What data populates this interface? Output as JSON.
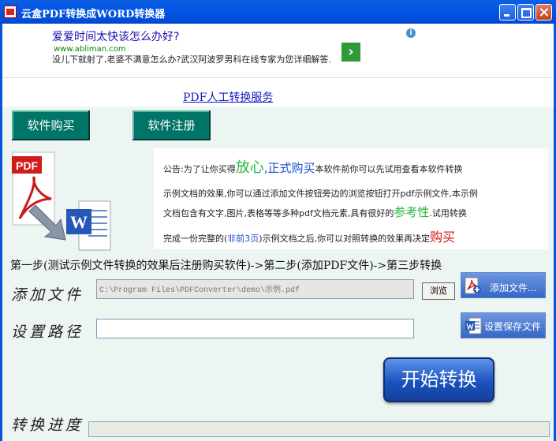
{
  "window": {
    "title": "云盒PDF转换成WORD转换器"
  },
  "ad": {
    "title": "爱爱时间太快该怎么办好?",
    "url": "www.abliman.com",
    "description": "没儿下就射了,老婆不满意怎么办?武汉阿波罗男科在线专家为您详细解答."
  },
  "service_link": "PDF人工转换服务",
  "buttons": {
    "buy": "软件购买",
    "register": "软件注册",
    "browse": "浏览",
    "add_file": "添加文件...",
    "save_path": "设置保存文件",
    "start": "开始转换"
  },
  "notice": {
    "p1": "公告:为了让你买得",
    "h1": "放心",
    "sep": ",",
    "h2": "正式购买",
    "p2": "本软件前你可以先试用查看本软件转换",
    "line2": "示例文档的效果,你可以通过添加文件按钮旁边的浏览按钮打开pdf示例文件,本示例",
    "p3": "文档包含有文字,图片,表格等等多种pdf文档元素,具有很好的",
    "h3": "参考性",
    "p4": ".试用转换",
    "p5": "完成一份完整的(",
    "h4": "非前3页",
    "p6": ")示例文档之后,你可以对照转换的效果再决定",
    "h5": "购买"
  },
  "steps": "第一步(测试示例文件转换的效果后注册购买软件)->第二步(添加PDF文件)->第三步转换",
  "labels": {
    "add_file": "添加文件",
    "set_path": "设置路径",
    "progress": "转换进度"
  },
  "inputs": {
    "file_path": "C:\\Program Files\\PDFConverter\\demo\\示例.pdf",
    "save_path": ""
  },
  "logos": {
    "pdf": "PDF",
    "word": "W"
  },
  "icons": [
    "pdf-logo-icon",
    "word-logo-icon",
    "arrow-icon",
    "pdf-add-icon",
    "word-save-icon",
    "info-icon",
    "arrow-right-icon"
  ]
}
